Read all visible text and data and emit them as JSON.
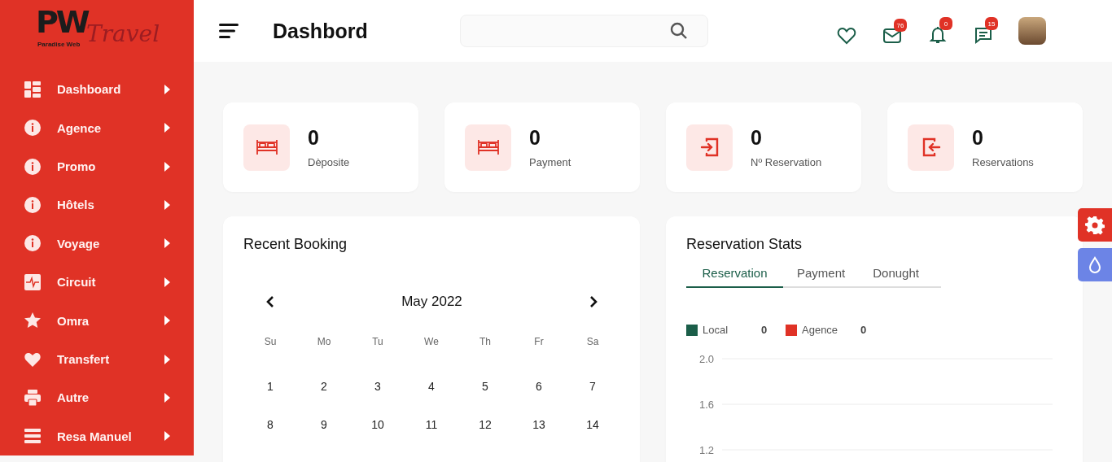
{
  "logo": {
    "mark": "PW",
    "script": "Travel",
    "tagline": "Paradise Web"
  },
  "sidebar": {
    "items": [
      {
        "label": "Dashboard"
      },
      {
        "label": "Agence"
      },
      {
        "label": "Promo"
      },
      {
        "label": "Hôtels"
      },
      {
        "label": "Voyage"
      },
      {
        "label": "Circuit"
      },
      {
        "label": "Omra"
      },
      {
        "label": "Transfert"
      },
      {
        "label": "Autre"
      },
      {
        "label": "Resa Manuel"
      }
    ]
  },
  "header": {
    "title": "Dashbord",
    "notifications": [
      {
        "kind": "heart"
      },
      {
        "kind": "mail",
        "badge": "76"
      },
      {
        "kind": "bell",
        "badge": "0"
      },
      {
        "kind": "chat",
        "badge": "15"
      }
    ]
  },
  "stat_cards": [
    {
      "kind": "bed",
      "value": "0",
      "label": "Dèposite"
    },
    {
      "kind": "bed",
      "value": "0",
      "label": "Payment"
    },
    {
      "kind": "login",
      "value": "0",
      "label": "Nº Reservation"
    },
    {
      "kind": "logout",
      "value": "0",
      "label": "Reservations"
    }
  ],
  "recent_booking": {
    "title": "Recent Booking",
    "calendar": {
      "month": "May 2022",
      "weekdays": [
        "Su",
        "Mo",
        "Tu",
        "We",
        "Th",
        "Fr",
        "Sa"
      ],
      "weeks": [
        [
          "1",
          "2",
          "3",
          "4",
          "5",
          "6",
          "7"
        ],
        [
          "8",
          "9",
          "10",
          "11",
          "12",
          "13",
          "14"
        ]
      ]
    }
  },
  "reservation_stats": {
    "title": "Reservation Stats",
    "tabs": [
      {
        "label": "Reservation",
        "selected": true
      },
      {
        "label": "Payment",
        "selected": false
      },
      {
        "label": "Donught",
        "selected": false
      }
    ],
    "legend": [
      {
        "label": "Local",
        "value": "0",
        "color": "#1b5e49"
      },
      {
        "label": "Agence",
        "value": "0",
        "color": "#e03226"
      }
    ],
    "axis_labels": [
      "2.0",
      "1.6",
      "1.2"
    ]
  }
}
